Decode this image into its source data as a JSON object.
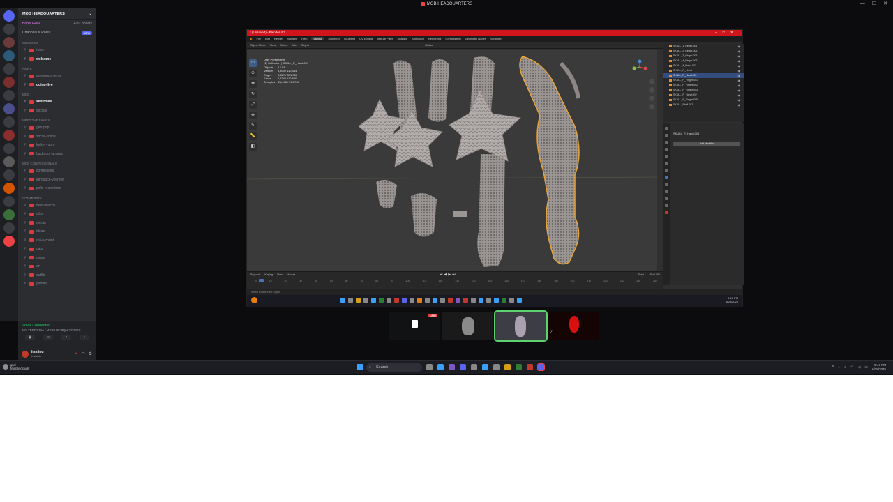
{
  "window": {
    "title": "MOB HEADQUARTERS",
    "controls": [
      "—",
      "☐",
      "✕"
    ]
  },
  "discord": {
    "server_name": "MOB HEADQUARTERS",
    "boost_goal_label": "Boost Goal",
    "boost_count": "4/20 Boosts",
    "channels_roles": "Channels & Roles",
    "new_badge": "NEW",
    "categories": [
      {
        "name": "WELCOME",
        "channels": [
          {
            "label": "rules",
            "bold": false
          },
          {
            "label": "welcome",
            "bold": true
          }
        ]
      },
      {
        "name": "NEWS",
        "channels": [
          {
            "label": "announcements",
            "bold": false
          },
          {
            "label": "going-live",
            "bold": true
          }
        ]
      },
      {
        "name": "MOB",
        "channels": [
          {
            "label": "self-roles",
            "bold": true
          },
          {
            "label": "socials",
            "bold": false
          }
        ]
      },
      {
        "name": "Meet the family",
        "channels": [
          {
            "label": "gen-pop",
            "bold": false
          },
          {
            "label": "social-scene",
            "bold": false
          },
          {
            "label": "locker-room",
            "bold": false
          },
          {
            "label": "backdoor-access",
            "bold": false
          }
        ]
      },
      {
        "name": "Mob Confessionals",
        "channels": [
          {
            "label": "confessions",
            "bold": false
          },
          {
            "label": "introduce-yourself",
            "bold": false
          },
          {
            "label": "polls-n-opinions",
            "bold": false
          }
        ]
      },
      {
        "name": "COMMUNITY",
        "channels": [
          {
            "label": "mob-vouchs",
            "bold": false
          },
          {
            "label": "clips",
            "bold": false
          },
          {
            "label": "media",
            "bold": false
          },
          {
            "label": "ideas",
            "bold": false
          },
          {
            "label": "roll-n-count",
            "bold": false
          },
          {
            "label": "cats",
            "bold": false
          },
          {
            "label": "music",
            "bold": false
          },
          {
            "label": "art",
            "bold": false
          },
          {
            "label": "outfits",
            "bold": false
          },
          {
            "label": "games",
            "bold": false
          }
        ]
      }
    ],
    "voice": {
      "status": "Voice Connected",
      "room": "MY TERRORIA / MOB HEADQUARTERS"
    },
    "user": {
      "name": "itssling",
      "status": "Invisible"
    },
    "host_user": {
      "name": "grel",
      "status": "Mostly cloudy"
    }
  },
  "blender": {
    "title": "* (Unsaved) - Blender 4.3",
    "menu": [
      "File",
      "Edit",
      "Render",
      "Window",
      "Help"
    ],
    "workspaces": [
      "Layout",
      "Modeling",
      "Sculpting",
      "UV Editing",
      "Texture Paint",
      "Shading",
      "Animation",
      "Rendering",
      "Compositing",
      "Geometry Nodes",
      "Scripting"
    ],
    "active_workspace": "Layout",
    "header": [
      "Object Mode",
      "View",
      "Select",
      "Add",
      "Object",
      "Global"
    ],
    "viewport_info": "User Perspective\n(1) Collection | SKULL_R_Hand.001\nObjects      1 / 14\nVertices     8,390 / 110,464\nEdges        8,367 / 331,350\nFaces        2,674 / 110,600\nTriangles    21,076 / 234,700",
    "outliner": [
      {
        "label": "SKULL_1_Finger.001",
        "selected": false
      },
      {
        "label": "SKULL_2_Finger.003",
        "selected": false
      },
      {
        "label": "SKULL_3_Finger.003",
        "selected": false
      },
      {
        "label": "SKULL_4_Finger.003",
        "selected": false
      },
      {
        "label": "SKULL_4_Hand.003",
        "selected": false
      },
      {
        "label": "SKULL_R_Hand",
        "selected": false
      },
      {
        "label": "SKULL_R_Hand.001",
        "selected": true
      },
      {
        "label": "SKULL_R_Finger.001",
        "selected": false
      },
      {
        "label": "SKULL_R_Finger.002",
        "selected": false
      },
      {
        "label": "SKULL_R_Finger.003",
        "selected": false
      },
      {
        "label": "SKULL_R_Hand.002",
        "selected": false
      },
      {
        "label": "SKULL_R_Finger.005",
        "selected": false
      },
      {
        "label": "SKULL_Skull.002",
        "selected": false
      }
    ],
    "properties_object": "SKULL_R_Hand.001",
    "add_modifier": "Add Modifier",
    "timeline": {
      "menu": [
        "Playback",
        "Keying",
        "View",
        "Marker"
      ],
      "frames": [
        "0",
        "10",
        "20",
        "30",
        "40",
        "50",
        "60",
        "70",
        "80",
        "90",
        "100",
        "110",
        "120",
        "130",
        "140",
        "150",
        "160",
        "170",
        "180",
        "190",
        "200",
        "210",
        "220",
        "230",
        "240",
        "250"
      ],
      "start": "Start 1",
      "end": "End 250"
    },
    "status_text": "Select          Rotate View          Object",
    "clock": {
      "time": "9:47 PM",
      "date": "6/28/2025"
    }
  },
  "tiles": [
    {
      "name": "stream-tile-1",
      "live": true,
      "live_label": "LIVE"
    },
    {
      "name": "stream-tile-2",
      "live": false
    },
    {
      "name": "stream-tile-3",
      "live": false
    },
    {
      "name": "stream-tile-4",
      "live": false
    }
  ],
  "taskbar": {
    "search_placeholder": "Search",
    "clock": {
      "time": "5:47 PM",
      "date": "6/28/2025"
    }
  },
  "colors": {
    "accent_red": "#d0161c",
    "discord_bg": "#2b2d31",
    "voice_green": "#23a559",
    "selection_blue": "#334d80",
    "orange_outline": "#e8a23a"
  }
}
